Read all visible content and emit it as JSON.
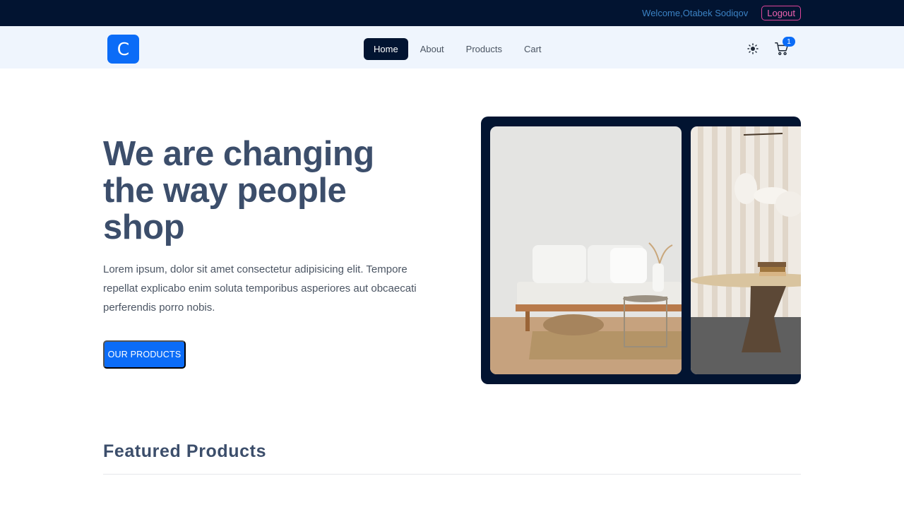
{
  "topbar": {
    "welcome": "Welcome,Otabek Sodiqov",
    "logout": "Logout"
  },
  "navbar": {
    "logo": "C",
    "links": [
      "Home",
      "About",
      "Products",
      "Cart"
    ],
    "active_link": "Home",
    "theme_icon": "sun-icon",
    "cart_icon": "cart-icon",
    "cart_count": "1"
  },
  "hero": {
    "title": "We are changing the way people shop",
    "text": "Lorem ipsum, dolor sit amet consectetur adipisicing elit. Tempore repellat explicabo enim soluta temporibus asperiores aut obcaecati perferendis porro nobis.",
    "button": "OUR PRODUCTS"
  },
  "featured": {
    "title": "Featured Products"
  },
  "colors": {
    "topbar_bg": "#021431",
    "accent": "#0b6cf7",
    "navbar_bg": "#eff5fd",
    "heading": "#3c4e6b",
    "logout_border": "#e0449a"
  }
}
